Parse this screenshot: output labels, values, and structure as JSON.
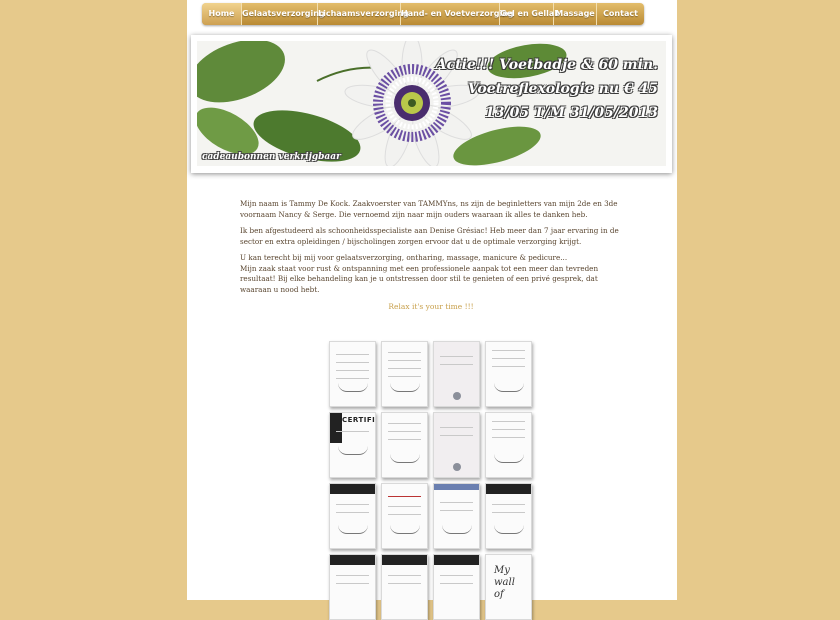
{
  "nav": {
    "items": [
      {
        "label": "Home",
        "active": true
      },
      {
        "label": "Gelaatsverzorging"
      },
      {
        "label": "Lichaamsverzorging"
      },
      {
        "label": "Hand- en Voetverzorging"
      },
      {
        "label": "Gel en Gellak"
      },
      {
        "label": "Massage"
      },
      {
        "label": "Contact"
      }
    ]
  },
  "banner": {
    "promo_line1": "Actie!!! Voetbadje & 60 min.",
    "promo_line2": "Voetreflexologie nu € 45",
    "promo_line3": "13/05 T/M 31/05/2013",
    "vouchers": "cadeaubonnen verkrijgbaar"
  },
  "intro": {
    "p1": "Mijn naam is Tammy De Kock. Zaakvoerster van TAMMYns, ns zijn de beginletters van mijn 2de en 3de voornaam Nancy & Serge. Die vernoemd zijn naar mijn ouders waaraan ik alles te danken heb.",
    "p2": "Ik ben afgestudeerd als schoonheidsspecialiste aan Denise Grésiac! Heb meer dan 7 jaar ervaring in de sector en extra opleidingen / bijscholingen zorgen ervoor dat u de optimale verzorging krijgt.",
    "p3a": "U kan terecht bij mij voor gelaatsverzorging, ontharing, massage, manicure & pedicure...",
    "p3b": "Mijn zaak staat voor rust & ontspanning met een professionele aanpak tot een meer dan tevreden resultaat! Bij elke behandeling kan je u ontstressen door stil te genieten of een privé gesprek, dat waaraan u nood hebt."
  },
  "tagline": "Relax it's your time !!!",
  "certificates": {
    "certific_label": "CERTIFIC",
    "wall_text_1": "My",
    "wall_text_2": "wall",
    "wall_text_3": "of"
  },
  "colors": {
    "background": "#e6c98b",
    "nav_gold": "#c99a45",
    "tagline": "#c8a04c"
  }
}
